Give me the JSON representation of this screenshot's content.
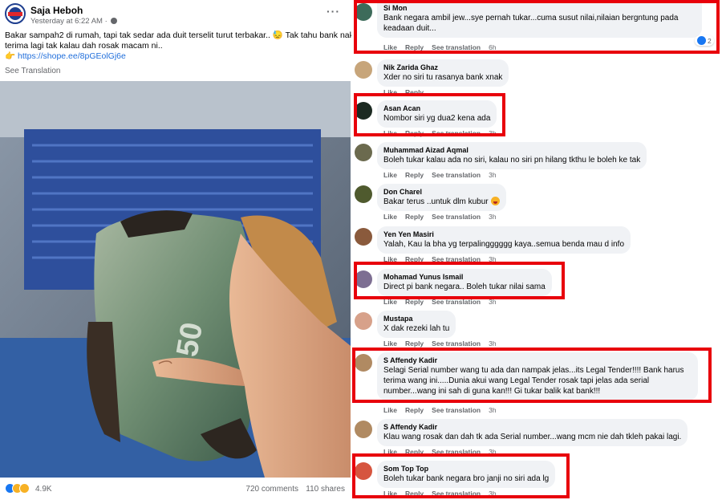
{
  "post": {
    "page_name": "Saja Heboh",
    "meta": "Yesterday at 6:22 AM",
    "meta_sep": "·",
    "more": "···",
    "line1": "Bakar sampah2 di rumah, tapi tak sedar ada duit terselit turut terbakar.. 😓 Tak tahu bank nak",
    "line2": "terima lagi tak kalau dah rosak macam ni..",
    "link_prefix": "👉 ",
    "link": "https://shope.ee/8pGEolGj6e",
    "see_translation": "See Translation",
    "reaction_count": "4.9K",
    "comments": "720 comments",
    "shares": "110 shares"
  },
  "comments": [
    {
      "name": "Si Mon",
      "text": "Bank negara ambil jew...sye pernah tukar...cuma susut nilai,nilaian bergntung pada keadaan duit...",
      "time": "6h",
      "likes": "2"
    },
    {
      "name": "Nik Zarida Ghaz",
      "text": "Xder no siri tu rasanya bank xnak",
      "time": ""
    },
    {
      "name": "Asan Acan",
      "text": "Nombor siri yg dua2 kena ada",
      "time": "3h"
    },
    {
      "name": "Muhammad Aizad Aqmal",
      "text": "Boleh tukar kalau ada no siri, kalau no siri pn hilang tkthu le boleh ke tak",
      "time": "3h"
    },
    {
      "name": "Don Charel",
      "text": "Bakar terus ..untuk dlm kubur",
      "time": "3h"
    },
    {
      "name": "Yen Yen Masiri",
      "text": "Yalah, Kau la bha yg terpalingggggg kaya..semua benda mau d info",
      "time": "3h"
    },
    {
      "name": "Mohamad Yunus Ismail",
      "text": "Direct pi bank negara.. Boleh tukar nilai sama",
      "time": "3h"
    },
    {
      "name": "Mustapa",
      "text": "X dak rezeki lah tu",
      "time": "3h"
    },
    {
      "name": "S Affendy Kadir",
      "text": "Selagi Serial number wang tu ada dan nampak jelas...its Legal Tender!!!! Bank harus terima wang ini.....Dunia akui wang Legal Tender rosak tapi jelas ada serial number...wang ini sah di guna kan!!! Gi tukar balik kat bank!!!",
      "time": "3h"
    },
    {
      "name": "S Affendy Kadir",
      "text": "Klau wang rosak dan dah tk ada Serial number...wang mcm nie dah tkleh pakai lagi.",
      "time": "3h"
    },
    {
      "name": "Som Top Top",
      "text": "Boleh tukar bank negara bro janji no siri ada lg",
      "time": "3h"
    }
  ],
  "actions": {
    "like": "Like",
    "reply": "Reply",
    "see_translation": "See translation"
  },
  "colors": {
    "highlight": "#e8000b",
    "bubble": "#f0f2f5",
    "link": "#216fdb",
    "meta": "#65676b"
  }
}
